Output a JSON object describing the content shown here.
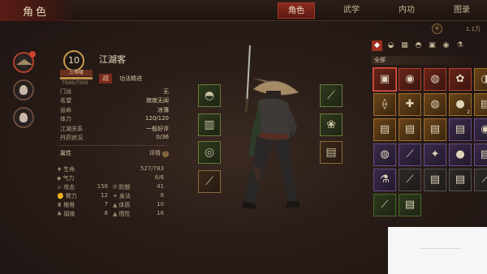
{
  "header": {
    "title": "角色",
    "tabs": [
      {
        "label": "角色",
        "active": true
      },
      {
        "label": "武学",
        "active": false
      },
      {
        "label": "内功",
        "active": false
      },
      {
        "label": "图录",
        "active": false
      }
    ]
  },
  "sidebar": {
    "characters": [
      {
        "name": "char-1",
        "active": true
      },
      {
        "name": "char-2",
        "active": false
      },
      {
        "name": "char-3",
        "active": false
      }
    ]
  },
  "character": {
    "level": "10",
    "rank": "三等级",
    "xp": "7500/7500",
    "xp_fraction": 1.0,
    "name": "江湖客",
    "school_badge": "战",
    "school_text": "功法精进",
    "fields": [
      {
        "label": "门派",
        "value": "无"
      },
      {
        "label": "名望",
        "value": "寂寂无闻"
      },
      {
        "label": "运命",
        "value": "凉薄"
      },
      {
        "label": "体力",
        "value": "120/120"
      },
      {
        "label": "江湖关系",
        "value": "一般好评"
      },
      {
        "label": "丹药状况",
        "value": "0/36"
      }
    ],
    "attr_title": "属性",
    "attr_detail": "评情",
    "hp_label": "生命",
    "hp_value": "527/783",
    "qi_label": "气力",
    "qi_value": "6/6",
    "stats": [
      {
        "label": "攻击",
        "value": "158",
        "icon": "⚔"
      },
      {
        "label": "防御",
        "value": "41",
        "icon": "⛨"
      },
      {
        "label": "臂力",
        "value": "12",
        "icon": "✊"
      },
      {
        "label": "身法",
        "value": "8",
        "icon": "✦"
      },
      {
        "label": "根骨",
        "value": "7",
        "icon": "♜"
      },
      {
        "label": "体质",
        "value": "10",
        "icon": "▲"
      },
      {
        "label": "福缘",
        "value": "8",
        "icon": "♣"
      },
      {
        "label": "悟性",
        "value": "16",
        "icon": "▲"
      }
    ]
  },
  "equipment": {
    "left": [
      {
        "icon": "hat-icon",
        "glyph": "◓"
      },
      {
        "icon": "armor-icon",
        "glyph": "▥"
      },
      {
        "icon": "boots-icon",
        "glyph": "◎"
      },
      {
        "icon": "sword-icon",
        "glyph": "⟋"
      }
    ],
    "right": [
      {
        "icon": "spear-icon",
        "glyph": "⟋"
      },
      {
        "icon": "herb-icon",
        "glyph": "❀"
      },
      {
        "icon": "scroll-icon",
        "glyph": "▤"
      },
      {
        "icon": "token-icon",
        "glyph": "▦"
      }
    ]
  },
  "inventory": {
    "money": "1.1万",
    "filter_label": "全部",
    "categories": [
      "◆",
      "◒",
      "▦",
      "◓",
      "▣",
      "◉",
      "⚗"
    ],
    "items": [
      {
        "glyph": "▣",
        "tone": "red",
        "sel": true
      },
      {
        "glyph": "◉",
        "tone": "red"
      },
      {
        "glyph": "◍",
        "tone": "red"
      },
      {
        "glyph": "✿",
        "tone": "red"
      },
      {
        "glyph": "◑",
        "tone": "orange"
      },
      {
        "glyph": "⟠",
        "tone": "orange"
      },
      {
        "glyph": "✚",
        "tone": "orange"
      },
      {
        "glyph": "◍",
        "tone": "orange"
      },
      {
        "glyph": "●",
        "tone": "orange",
        "count": "2"
      },
      {
        "glyph": "▤",
        "tone": "orange"
      },
      {
        "glyph": "▤",
        "tone": "orange"
      },
      {
        "glyph": "▤",
        "tone": "orange"
      },
      {
        "glyph": "▤",
        "tone": "orange"
      },
      {
        "glyph": "▤",
        "tone": "purple"
      },
      {
        "glyph": "◉",
        "tone": "purple"
      },
      {
        "glyph": "◍",
        "tone": "purple"
      },
      {
        "glyph": "⟋",
        "tone": "purple"
      },
      {
        "glyph": "✦",
        "tone": "purple"
      },
      {
        "glyph": "●",
        "tone": "purple"
      },
      {
        "glyph": "▤",
        "tone": "purple"
      },
      {
        "glyph": "⚗",
        "tone": "purple"
      },
      {
        "glyph": "⟋",
        "tone": "gray"
      },
      {
        "glyph": "▤",
        "tone": "gray"
      },
      {
        "glyph": "▤",
        "tone": "gray"
      },
      {
        "glyph": "⟋",
        "tone": "gray"
      },
      {
        "glyph": "⟋",
        "tone": "green"
      },
      {
        "glyph": "▤",
        "tone": "green"
      }
    ]
  }
}
